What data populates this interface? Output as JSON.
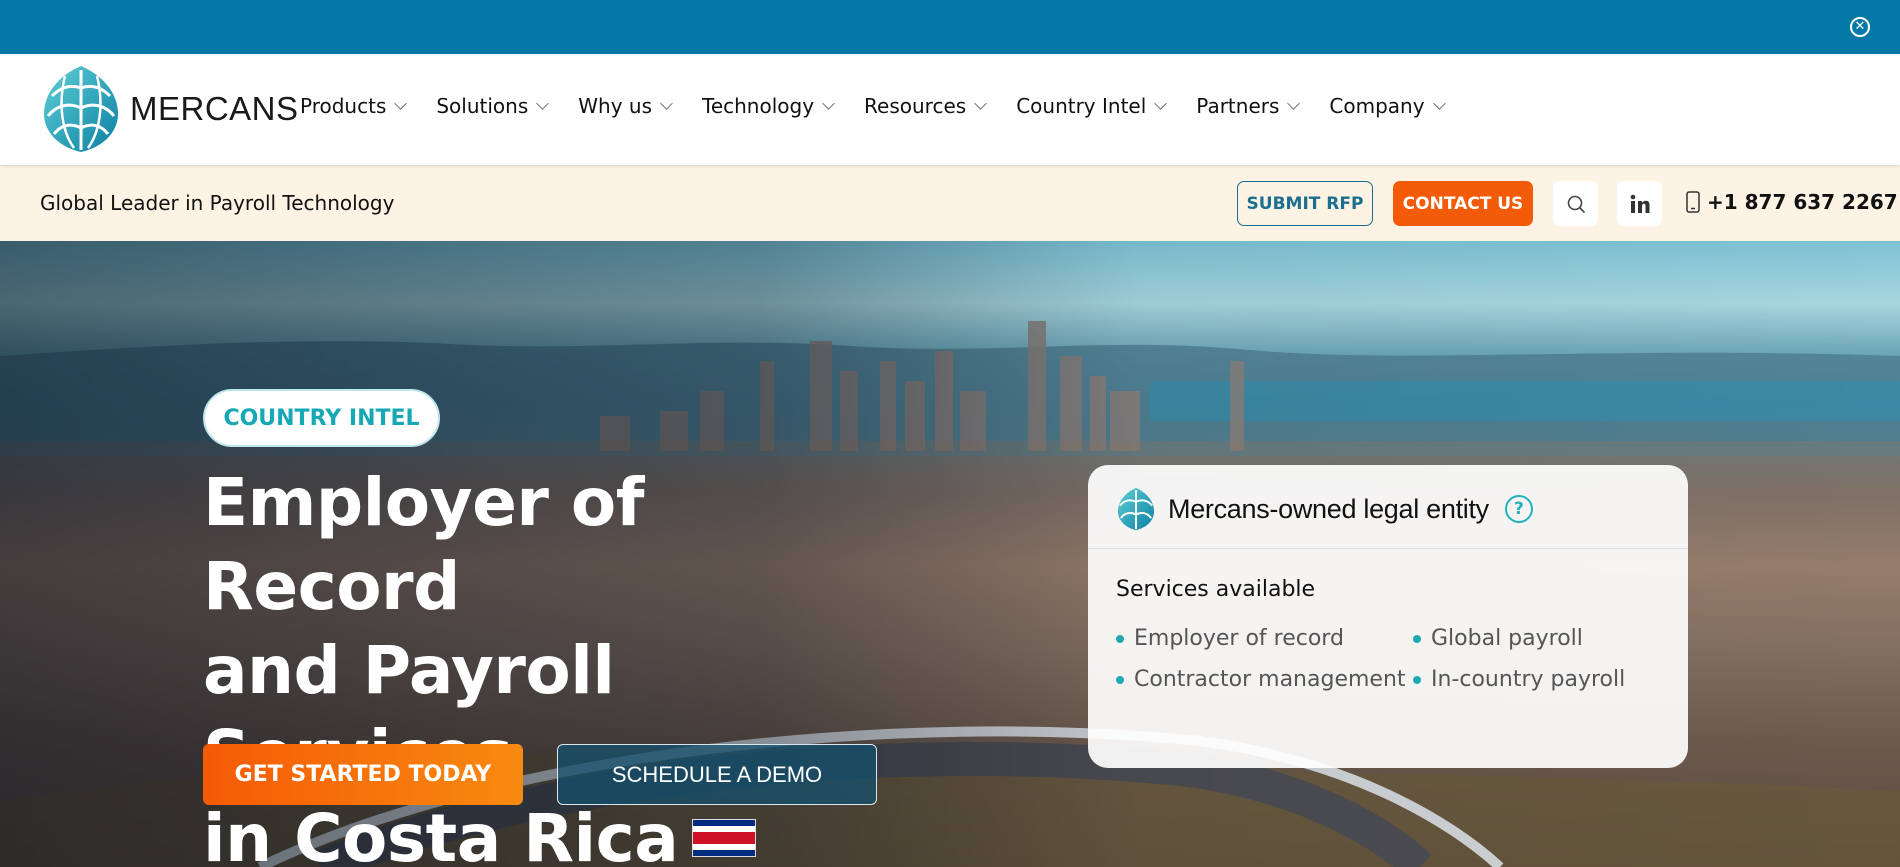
{
  "brand": {
    "name": "MERCANS"
  },
  "top_bar": {
    "close_icon": "close-circle-icon"
  },
  "nav": {
    "items": [
      {
        "label": "Products"
      },
      {
        "label": "Solutions"
      },
      {
        "label": "Why us"
      },
      {
        "label": "Technology"
      },
      {
        "label": "Resources"
      },
      {
        "label": "Country Intel"
      },
      {
        "label": "Partners"
      },
      {
        "label": "Company"
      }
    ]
  },
  "sub_bar": {
    "tagline": "Global Leader in Payroll Technology",
    "submit_rfp": "SUBMIT RFP",
    "contact_us": "CONTACT US",
    "phone": "+1 877 637 2267"
  },
  "hero": {
    "badge": "COUNTRY INTEL",
    "title_line1": "Employer of Record",
    "title_line2": "and Payroll Services",
    "title_line3": "in Costa Rica",
    "cta_primary": "GET STARTED TODAY",
    "cta_secondary": "SCHEDULE A DEMO"
  },
  "info_card": {
    "heading": "Mercans-owned legal entity",
    "help_mark": "?",
    "services_label": "Services available",
    "services": [
      "Employer of record",
      "Global payroll",
      "Contractor management",
      "In-country payroll"
    ]
  },
  "colors": {
    "top_bar": "#0479a6",
    "accent_orange": "#f45b08",
    "teal": "#16a8b4",
    "sub_bar_bg": "#fdf3e4"
  }
}
